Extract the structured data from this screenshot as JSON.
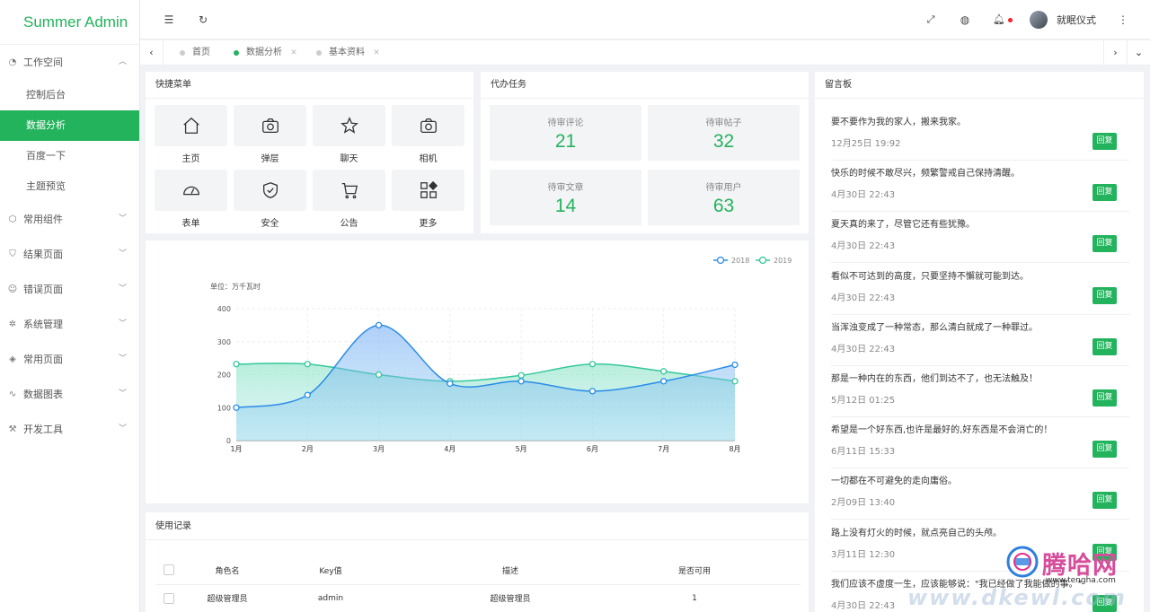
{
  "app": {
    "title": "Summer Admin"
  },
  "sidebar": {
    "groups": [
      {
        "label": "工作空间",
        "icon": "dashboard-icon",
        "expanded": true,
        "children": [
          {
            "label": "控制后台",
            "active": false
          },
          {
            "label": "数据分析",
            "active": true
          },
          {
            "label": "百度一下",
            "active": false
          },
          {
            "label": "主题预览",
            "active": false
          }
        ]
      },
      {
        "label": "常用组件",
        "icon": "cube-icon"
      },
      {
        "label": "结果页面",
        "icon": "shield-check-icon"
      },
      {
        "label": "错误页面",
        "icon": "smile-icon"
      },
      {
        "label": "系统管理",
        "icon": "gear-icon"
      },
      {
        "label": "常用页面",
        "icon": "layers-icon"
      },
      {
        "label": "数据图表",
        "icon": "pulse-icon"
      },
      {
        "label": "开发工具",
        "icon": "tool-icon"
      }
    ]
  },
  "header": {
    "icons": [
      "menu-fold-icon",
      "refresh-icon",
      "fullscreen-icon",
      "globe-icon",
      "bell-icon",
      "more-icon"
    ],
    "user": {
      "name": "就眠仪式"
    }
  },
  "tabs": [
    {
      "label": "首页",
      "active": false,
      "closable": false
    },
    {
      "label": "数据分析",
      "active": true,
      "closable": true
    },
    {
      "label": "基本资料",
      "active": false,
      "closable": true
    }
  ],
  "quick_menu": {
    "title": "快捷菜单",
    "items": [
      {
        "label": "主页",
        "icon": "home-icon"
      },
      {
        "label": "弹层",
        "icon": "camera-icon"
      },
      {
        "label": "聊天",
        "icon": "star-icon"
      },
      {
        "label": "相机",
        "icon": "camera-icon"
      },
      {
        "label": "表单",
        "icon": "gauge-icon"
      },
      {
        "label": "安全",
        "icon": "shield-check-icon"
      },
      {
        "label": "公告",
        "icon": "cart-icon"
      },
      {
        "label": "更多",
        "icon": "apps-icon"
      }
    ]
  },
  "tasks": {
    "title": "代办任务",
    "items": [
      {
        "label": "待审评论",
        "value": "21"
      },
      {
        "label": "待审帖子",
        "value": "32"
      },
      {
        "label": "待审文章",
        "value": "14"
      },
      {
        "label": "待审用户",
        "value": "63"
      }
    ]
  },
  "chart_data": {
    "type": "area",
    "unit_label": "单位：万千瓦时",
    "categories": [
      "1月",
      "2月",
      "3月",
      "4月",
      "5月",
      "6月",
      "7月",
      "8月"
    ],
    "ylim": [
      0,
      400
    ],
    "yticks": [
      "0",
      "100",
      "200",
      "300",
      "400"
    ],
    "legend_position": "top-right",
    "grid": true,
    "series": [
      {
        "name": "2018",
        "color": "#2b8ce8",
        "values": [
          100,
          138,
          350,
          173,
          180,
          150,
          180,
          230
        ]
      },
      {
        "name": "2019",
        "color": "#35c79a",
        "values": [
          232,
          232,
          200,
          180,
          198,
          232,
          210,
          180
        ]
      }
    ]
  },
  "guestbook": {
    "title": "留言板",
    "reply_label": "回复",
    "messages": [
      {
        "text": "要不要作为我的家人，搬来我家。",
        "time": "12月25日 19:92"
      },
      {
        "text": "快乐的时候不敢尽兴，频繁警戒自己保持清醒。",
        "time": "4月30日 22:43"
      },
      {
        "text": "夏天真的来了，尽管它还有些犹豫。",
        "time": "4月30日 22:43"
      },
      {
        "text": "看似不可达到的高度，只要坚持不懈就可能到达。",
        "time": "4月30日 22:43"
      },
      {
        "text": "当浑浊变成了一种常态，那么清白就成了一种罪过。",
        "time": "4月30日 22:43"
      },
      {
        "text": "那是一种内在的东西，他们到达不了，也无法触及！",
        "time": "5月12日 01:25"
      },
      {
        "text": "希望是一个好东西,也许是最好的,好东西是不会消亡的！",
        "time": "6月11日 15:33"
      },
      {
        "text": "一切都在不可避免的走向庸俗。",
        "time": "2月09日 13:40"
      },
      {
        "text": "路上没有灯火的时候，就点亮自己的头颅。",
        "time": "3月11日 12:30"
      },
      {
        "text": "我们应该不虚度一生，应该能够说：\"我已经做了我能做的事。\"",
        "time": "4月30日 22:43"
      }
    ]
  },
  "usage": {
    "title": "使用记录",
    "columns": [
      "角色名",
      "Key值",
      "描述",
      "是否可用"
    ],
    "rows": [
      [
        "超级管理员",
        "admin",
        "超级管理员",
        "1"
      ]
    ]
  },
  "watermark": {
    "brand": "腾哈网",
    "url": "www.tengha.com",
    "overlay": "www.dkewl.com"
  }
}
